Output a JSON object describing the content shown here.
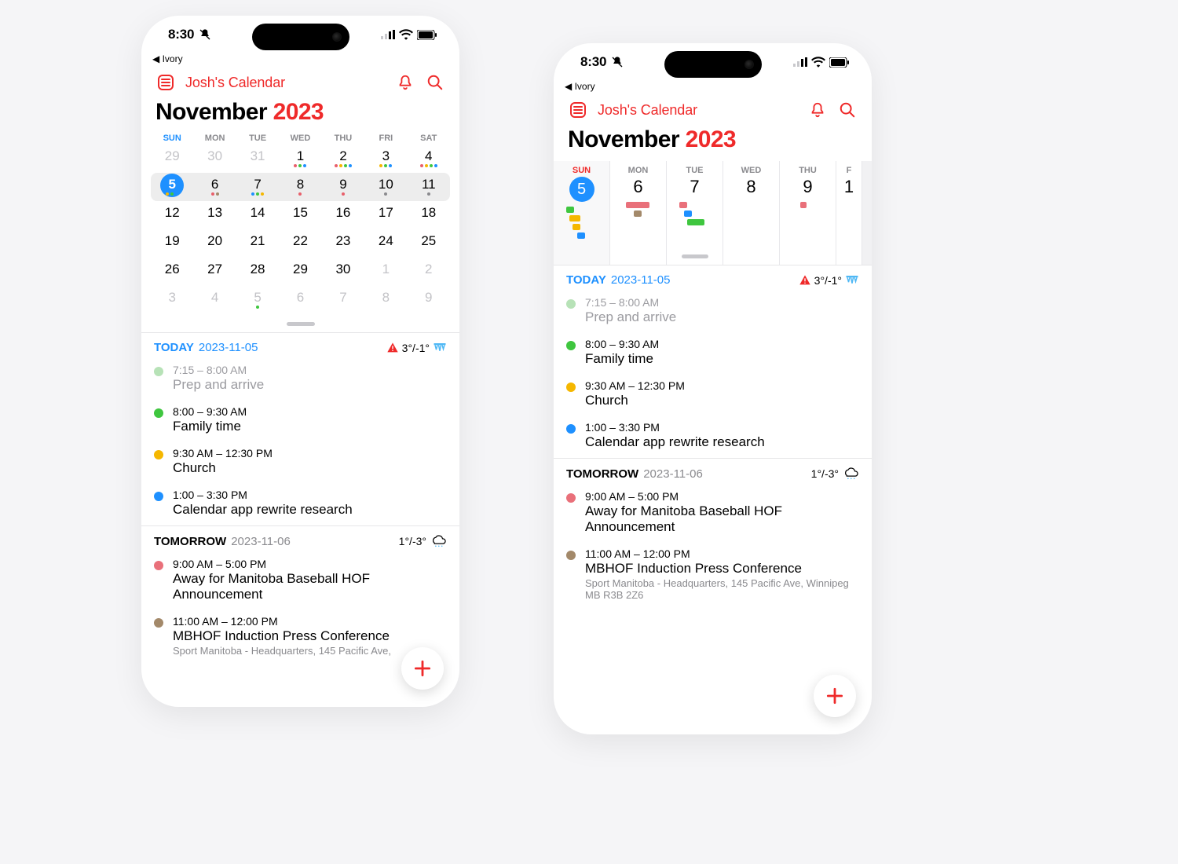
{
  "status": {
    "time": "8:30",
    "back_app": "◀ Ivory"
  },
  "header": {
    "calendar_name": "Josh's Calendar"
  },
  "month": {
    "name": "November",
    "year": "2023"
  },
  "weekdays": [
    "SUN",
    "MON",
    "TUE",
    "WED",
    "THU",
    "FRI",
    "SAT"
  ],
  "month_grid": [
    [
      {
        "n": "29",
        "dim": true,
        "dots": []
      },
      {
        "n": "30",
        "dim": true,
        "dots": []
      },
      {
        "n": "31",
        "dim": true,
        "dots": []
      },
      {
        "n": "1",
        "dots": [
          "#e85f6b",
          "#3fc63f",
          "#1e90ff"
        ]
      },
      {
        "n": "2",
        "dots": [
          "#e85f6b",
          "#f5b700",
          "#3fc63f",
          "#1e90ff"
        ]
      },
      {
        "n": "3",
        "dots": [
          "#f5b700",
          "#3fc63f",
          "#1e90ff"
        ]
      },
      {
        "n": "4",
        "dots": [
          "#e85f6b",
          "#f5b700",
          "#3fc63f",
          "#1e90ff"
        ]
      }
    ],
    [
      {
        "n": "5",
        "today": true,
        "dots": [
          "#f5b700",
          "#3fc63f",
          "#1e90ff"
        ]
      },
      {
        "n": "6",
        "dots": [
          "#e85f6b",
          "#a3896a"
        ]
      },
      {
        "n": "7",
        "dots": [
          "#1e90ff",
          "#3fc63f",
          "#f5b700"
        ]
      },
      {
        "n": "8",
        "dots": [
          "#e85f6b"
        ]
      },
      {
        "n": "9",
        "dots": [
          "#e85f6b"
        ]
      },
      {
        "n": "10",
        "dots": [
          "#8a8a8e"
        ]
      },
      {
        "n": "11",
        "dots": [
          "#8a8a8e"
        ]
      }
    ],
    [
      {
        "n": "12",
        "dots": []
      },
      {
        "n": "13",
        "dots": []
      },
      {
        "n": "14",
        "dots": []
      },
      {
        "n": "15",
        "dots": []
      },
      {
        "n": "16",
        "dots": []
      },
      {
        "n": "17",
        "dots": []
      },
      {
        "n": "18",
        "dots": []
      }
    ],
    [
      {
        "n": "19",
        "dots": []
      },
      {
        "n": "20",
        "dots": []
      },
      {
        "n": "21",
        "dots": []
      },
      {
        "n": "22",
        "dots": []
      },
      {
        "n": "23",
        "dots": []
      },
      {
        "n": "24",
        "dots": []
      },
      {
        "n": "25",
        "dots": []
      }
    ],
    [
      {
        "n": "26",
        "dots": []
      },
      {
        "n": "27",
        "dots": []
      },
      {
        "n": "28",
        "dots": []
      },
      {
        "n": "29",
        "dots": []
      },
      {
        "n": "30",
        "dots": []
      },
      {
        "n": "1",
        "dim": true,
        "dots": []
      },
      {
        "n": "2",
        "dim": true,
        "dots": []
      }
    ],
    [
      {
        "n": "3",
        "dim": true,
        "dots": []
      },
      {
        "n": "4",
        "dim": true,
        "dots": []
      },
      {
        "n": "5",
        "dim": true,
        "dots": [
          "#3fc63f"
        ]
      },
      {
        "n": "6",
        "dim": true,
        "dots": []
      },
      {
        "n": "7",
        "dim": true,
        "dots": []
      },
      {
        "n": "8",
        "dim": true,
        "dots": []
      },
      {
        "n": "9",
        "dim": true,
        "dots": []
      }
    ]
  ],
  "weekstrip": [
    {
      "dow": "SUN",
      "n": "5",
      "today": true,
      "blocks": [
        {
          "c": "#3fc63f",
          "w": 10,
          "x": 0
        },
        {
          "c": "#f5b700",
          "w": 14,
          "x": 4
        },
        {
          "c": "#f5b700",
          "w": 10,
          "x": 8
        },
        {
          "c": "#1e90ff",
          "w": 10,
          "x": 14
        }
      ]
    },
    {
      "dow": "MON",
      "n": "6",
      "blocks": [
        {
          "c": "#e9707a",
          "w": 30,
          "x": 4
        },
        {
          "c": "#a3896a",
          "w": 10,
          "x": 14
        }
      ]
    },
    {
      "dow": "TUE",
      "n": "7",
      "blocks": [
        {
          "c": "#e9707a",
          "w": 10,
          "x": 0
        },
        {
          "c": "#1e90ff",
          "w": 10,
          "x": 6
        },
        {
          "c": "#3fc63f",
          "w": 22,
          "x": 10
        }
      ]
    },
    {
      "dow": "WED",
      "n": "8",
      "blocks": []
    },
    {
      "dow": "THU",
      "n": "9",
      "blocks": [
        {
          "c": "#e9707a",
          "w": 8,
          "x": 10
        }
      ]
    },
    {
      "dow": "F",
      "n": "1",
      "partial": true,
      "blocks": []
    }
  ],
  "sections": [
    {
      "label": "TODAY",
      "date": "2023-11-05",
      "today": true,
      "alert": true,
      "temp": "3°/-1°",
      "icicle": true,
      "events": [
        {
          "color": "#b7e2b7",
          "time": "7:15 – 8:00 AM",
          "title": "Prep and arrive",
          "dim": true
        },
        {
          "color": "#3fc63f",
          "time": "8:00 – 9:30 AM",
          "title": "Family time"
        },
        {
          "color": "#f5b700",
          "time": "9:30 AM – 12:30 PM",
          "title": "Church"
        },
        {
          "color": "#1e90ff",
          "time": "1:00 – 3:30 PM",
          "title": "Calendar app rewrite research"
        }
      ]
    },
    {
      "label": "TOMORROW",
      "date": "2023-11-06",
      "today": false,
      "temp": "1°/-3°",
      "cloud": true,
      "events": [
        {
          "color": "#e9707a",
          "time": "9:00 AM – 5:00 PM",
          "title": "Away for Manitoba Baseball HOF Announcement"
        },
        {
          "color": "#a3896a",
          "time": "11:00 AM – 12:00 PM",
          "title": "MBHOF Induction Press Conference",
          "loc": "Sport Manitoba - Headquarters, 145 Pacific Ave, Winnipeg MB R3B 2Z6",
          "loc_short": "Sport Manitoba - Headquarters, 145 Pacific Ave,"
        }
      ]
    }
  ]
}
